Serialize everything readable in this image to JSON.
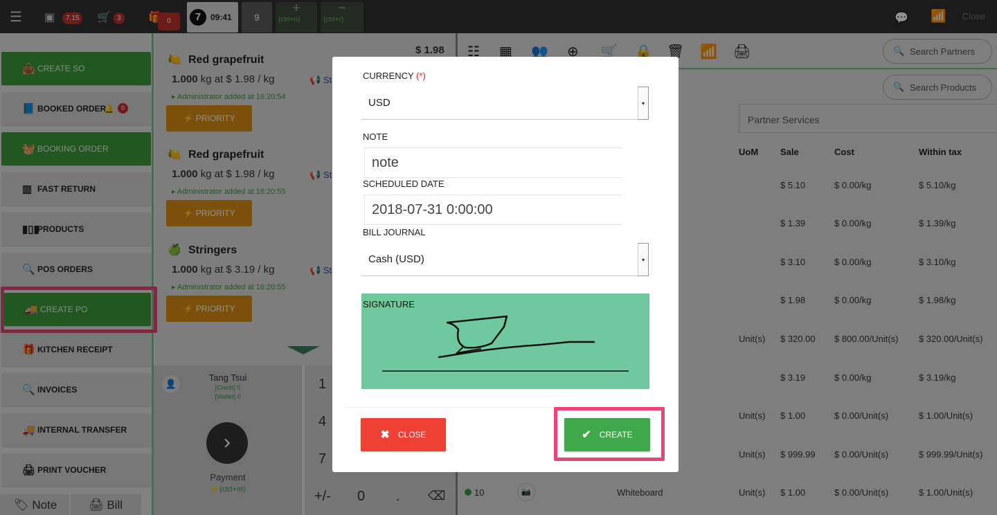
{
  "topbar": {
    "badge_money": "7.15",
    "badge_cart": "3",
    "badge_gift": "0",
    "tab_active_num": "7",
    "tab_active_time": "09:41",
    "tab_two_num": "9",
    "add_shortcut": "(ctrl+n)",
    "remove_shortcut": "(ctrl+r)",
    "close_label": "Close"
  },
  "sidebar": {
    "items": [
      {
        "label": "CREATE SO"
      },
      {
        "label": "BOOKED ORDERS"
      },
      {
        "label": "BOOKING ORDER"
      },
      {
        "label": "FAST RETURN"
      },
      {
        "label": "PRODUCTS"
      },
      {
        "label": "POS ORDERS"
      },
      {
        "label": "CREATE PO"
      },
      {
        "label": "KITCHEN RECEIPT"
      },
      {
        "label": "INVOICES"
      },
      {
        "label": "INTERNAL TRANSFER"
      },
      {
        "label": "PRINT VOUCHER"
      }
    ],
    "booked_badge": "0",
    "note_label": "Note",
    "bill_label": "Bill"
  },
  "order": {
    "total": "$ 1.98",
    "lines": [
      {
        "name": "Red grapefruit",
        "qty": "1.000",
        "detail": "kg at $ 1.98 / kg",
        "added": "Administrator added at 16:20:54",
        "priority": "PRIORITY",
        "star": "Sta"
      },
      {
        "name": "Red grapefruit",
        "qty": "1.000",
        "detail": "kg at $ 1.98 / kg",
        "added": "Administrator added at 16:20:55",
        "priority": "PRIORITY",
        "star": "Sta"
      },
      {
        "name": "Stringers",
        "qty": "1.000",
        "detail": "kg at $ 3.19 / kg",
        "added": "Administrator added at 16:20:55",
        "priority": "PRIORITY",
        "star": "Sta"
      }
    ]
  },
  "customer": {
    "name": "Tang Tsui",
    "credit": "[Credit] 0",
    "wallet": "[Wallet] 0",
    "payment_label": "Payment",
    "payment_shortcut": "(ctrl+m)"
  },
  "numpad": {
    "k1": "1",
    "k4": "4",
    "k7": "7",
    "plusminus": "+/-",
    "zero": "0",
    "dot": "."
  },
  "right": {
    "search_partners": "Search Partners",
    "search_products": "Search Products",
    "partner_services": "Partner Services",
    "headers": {
      "uom": "UoM",
      "sale": "Sale",
      "cost": "Cost",
      "within_tax": "Within tax"
    },
    "rows": [
      {
        "uom": "",
        "sale": "$ 5.10",
        "cost": "$ 0.00/kg",
        "tax": "$ 5.10/kg"
      },
      {
        "uom": "",
        "sale": "$ 1.39",
        "cost": "$ 0.00/kg",
        "tax": "$ 1.39/kg"
      },
      {
        "uom": "",
        "sale": "$ 3.10",
        "cost": "$ 0.00/kg",
        "tax": "$ 3.10/kg"
      },
      {
        "uom": "",
        "sale": "$ 1.98",
        "cost": "$ 0.00/kg",
        "tax": "$ 1.98/kg"
      },
      {
        "uom": "Unit(s)",
        "sale": "$ 320.00",
        "cost": "$ 800.00/Unit(s)",
        "tax": "$ 320.00/Unit(s)"
      },
      {
        "uom": "",
        "sale": "$ 3.19",
        "cost": "$ 0.00/kg",
        "tax": "$ 3.19/kg"
      },
      {
        "uom": "Unit(s)",
        "sale": "$ 1.00",
        "cost": "$ 0.00/Unit(s)",
        "tax": "$ 1.00/Unit(s)"
      },
      {
        "uom": "Unit(s)",
        "sale": "$ 999.99",
        "cost": "$ 0.00/Unit(s)",
        "tax": "$ 999.99/Unit(s)"
      },
      {
        "uom": "Unit(s)",
        "sale": "$ 1.00",
        "cost": "$ 0.00/Unit(s)",
        "tax": "$ 1.00/Unit(s)"
      }
    ],
    "last_row_qty": "10",
    "last_row_name": "Whiteboard"
  },
  "modal": {
    "currency_label": "CURRENCY",
    "required_mark": "(*)",
    "currency_value": "USD",
    "note_label": "NOTE",
    "note_value": "note",
    "scheduled_label": "SCHEDULED DATE",
    "scheduled_value": "2018-07-31 0:00:00",
    "journal_label": "BILL JOURNAL",
    "journal_value": "Cash (USD)",
    "signature_label": "SIGNATURE",
    "close_button": "CLOSE",
    "create_button": "CREATE"
  },
  "colors": {
    "green": "#3c9a3c",
    "priority": "#d98e14",
    "close_red": "#ee4035",
    "create_green": "#3ea84a",
    "signature_bg": "#6fc99c",
    "highlight": "#e64576"
  }
}
